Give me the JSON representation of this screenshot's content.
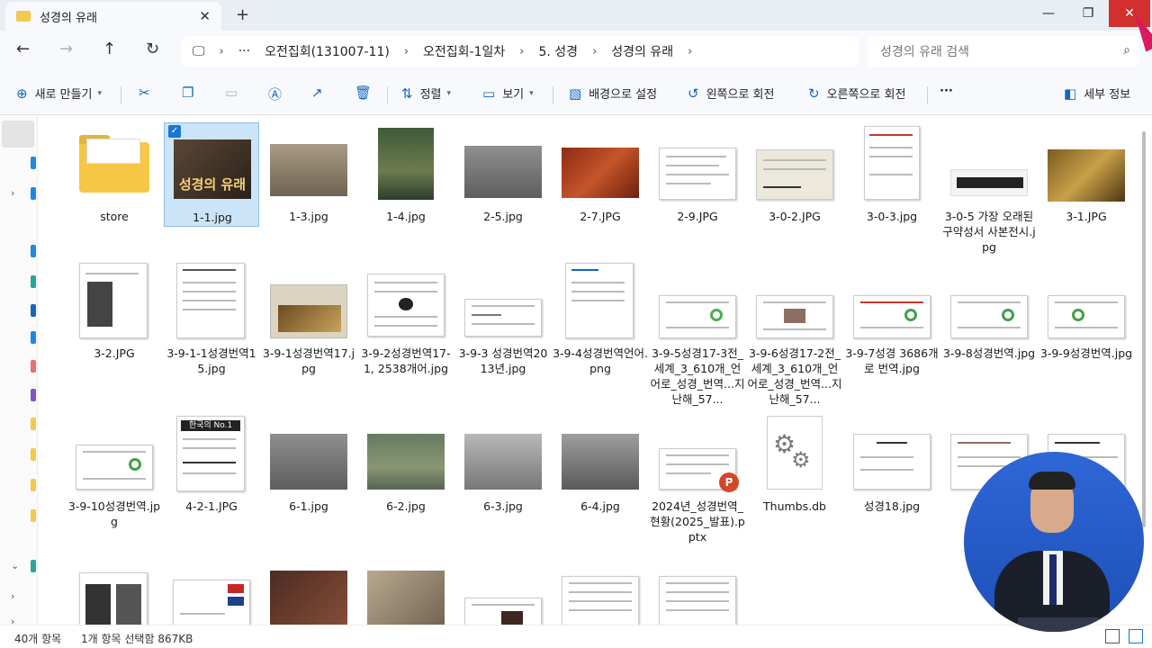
{
  "window": {
    "tab_title": "성경의 유래",
    "close_glyph": "✕",
    "new_tab_glyph": "+",
    "minimize_glyph": "—",
    "maximize_glyph": "❐"
  },
  "nav": {
    "back": "←",
    "forward": "→",
    "up": "↑",
    "refresh": "↻"
  },
  "breadcrumbs": {
    "pc_glyph": "🖵",
    "items": [
      "›",
      "···",
      "오전집회(131007-11)",
      "›",
      "오전집회-1일차",
      "›",
      "5. 성경",
      "›",
      "성경의 유래",
      "›"
    ]
  },
  "search": {
    "placeholder": "성경의 유래 검색",
    "icon": "search-icon"
  },
  "toolbar": {
    "new_label": "새로 만들기",
    "sort_label": "정렬",
    "view_label": "보기",
    "set_background_label": "배경으로 설정",
    "rotate_left_label": "왼쪽으로 회전",
    "rotate_right_label": "오른쪽으로 회전",
    "more_label": "···",
    "details_label": "세부 정보"
  },
  "files": [
    {
      "name": "store",
      "kind": "folder"
    },
    {
      "name": "1-1.jpg",
      "kind": "image",
      "selected": true,
      "overlay_text": "성경의 유래"
    },
    {
      "name": "1-3.jpg",
      "kind": "image"
    },
    {
      "name": "1-4.jpg",
      "kind": "image"
    },
    {
      "name": "2-5.jpg",
      "kind": "image"
    },
    {
      "name": "2-7.JPG",
      "kind": "image"
    },
    {
      "name": "2-9.JPG",
      "kind": "image"
    },
    {
      "name": "3-0-2.JPG",
      "kind": "image"
    },
    {
      "name": "3-0-3.jpg",
      "kind": "image"
    },
    {
      "name": "3-0-5 가장 오래된 구약성서 사본전시.jpg",
      "kind": "image"
    },
    {
      "name": "3-1.JPG",
      "kind": "image"
    },
    {
      "name": "3-2.JPG",
      "kind": "image"
    },
    {
      "name": "3-9-1-1성경번역15.jpg",
      "kind": "image"
    },
    {
      "name": "3-9-1성경번역17.jpg",
      "kind": "image"
    },
    {
      "name": "3-9-2성경번역17-1, 2538개어.jpg",
      "kind": "image"
    },
    {
      "name": "3-9-3 성경번역2013년.jpg",
      "kind": "image"
    },
    {
      "name": "3-9-4성경번역언어.png",
      "kind": "image"
    },
    {
      "name": "3-9-5성경17-3전_세계_3_610개_언어로_성경_번역...지난해_57...",
      "kind": "image"
    },
    {
      "name": "3-9-6성경17-2전_세계_3_610개_언어로_성경_번역...지난해_57...",
      "kind": "image"
    },
    {
      "name": "3-9-7성경 3686개로 번역.jpg",
      "kind": "image"
    },
    {
      "name": "3-9-8성경번역.jpg",
      "kind": "image"
    },
    {
      "name": "3-9-9성경번역.jpg",
      "kind": "image"
    },
    {
      "name": "3-9-10성경번역.jpg",
      "kind": "image"
    },
    {
      "name": "4-2-1.JPG",
      "kind": "image",
      "overlay_text": "한국의 No.1"
    },
    {
      "name": "6-1.jpg",
      "kind": "image"
    },
    {
      "name": "6-2.jpg",
      "kind": "image"
    },
    {
      "name": "6-3.jpg",
      "kind": "image"
    },
    {
      "name": "6-4.jpg",
      "kind": "image"
    },
    {
      "name": "2024년_성경번역_현황(2025_발표).pptx",
      "kind": "pptx"
    },
    {
      "name": "Thumbs.db",
      "kind": "db"
    },
    {
      "name": "성경18.jpg",
      "kind": "image"
    }
  ],
  "status": {
    "item_count": "40개 항목",
    "selection": "1개 항목 선택함 867KB"
  },
  "colors": {
    "accent": "#1976d2",
    "selection_bg": "#cce4f7",
    "close_button": "#d32f2f",
    "overlay_bg": "#2f67d6"
  }
}
